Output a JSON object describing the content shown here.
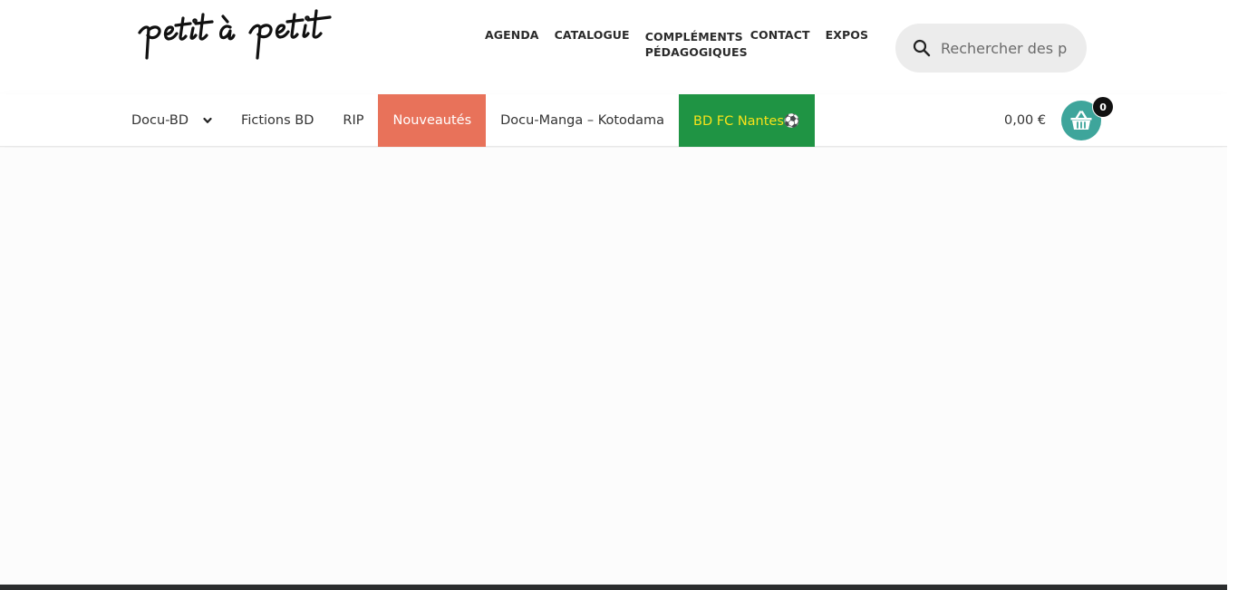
{
  "header": {
    "logo_text": "petit à petit",
    "top_nav": [
      {
        "label": "AGENDA"
      },
      {
        "label": "CATALOGUE"
      },
      {
        "label": "COMPLÉMENTS PÉDAGOGIQUES"
      },
      {
        "label": "CONTACT"
      },
      {
        "label": "EXPOS"
      }
    ],
    "search": {
      "placeholder": "Rechercher des produits",
      "icon": "search-icon"
    }
  },
  "category_nav": {
    "items": [
      {
        "label": "Docu-BD",
        "has_dropdown": true
      },
      {
        "label": "Fictions BD"
      },
      {
        "label": "RIP"
      },
      {
        "label": "Nouveautés",
        "highlight_color": "#e8725a"
      },
      {
        "label": "Docu-Manga – Kotodama"
      },
      {
        "label": "BD FC Nantes⚽",
        "highlight_color": "#1f9444",
        "text_color": "#f7e21a"
      }
    ]
  },
  "cart": {
    "amount": "0,00 €",
    "count": "0",
    "icon": "basket-icon",
    "accent": "#3ea59b"
  }
}
